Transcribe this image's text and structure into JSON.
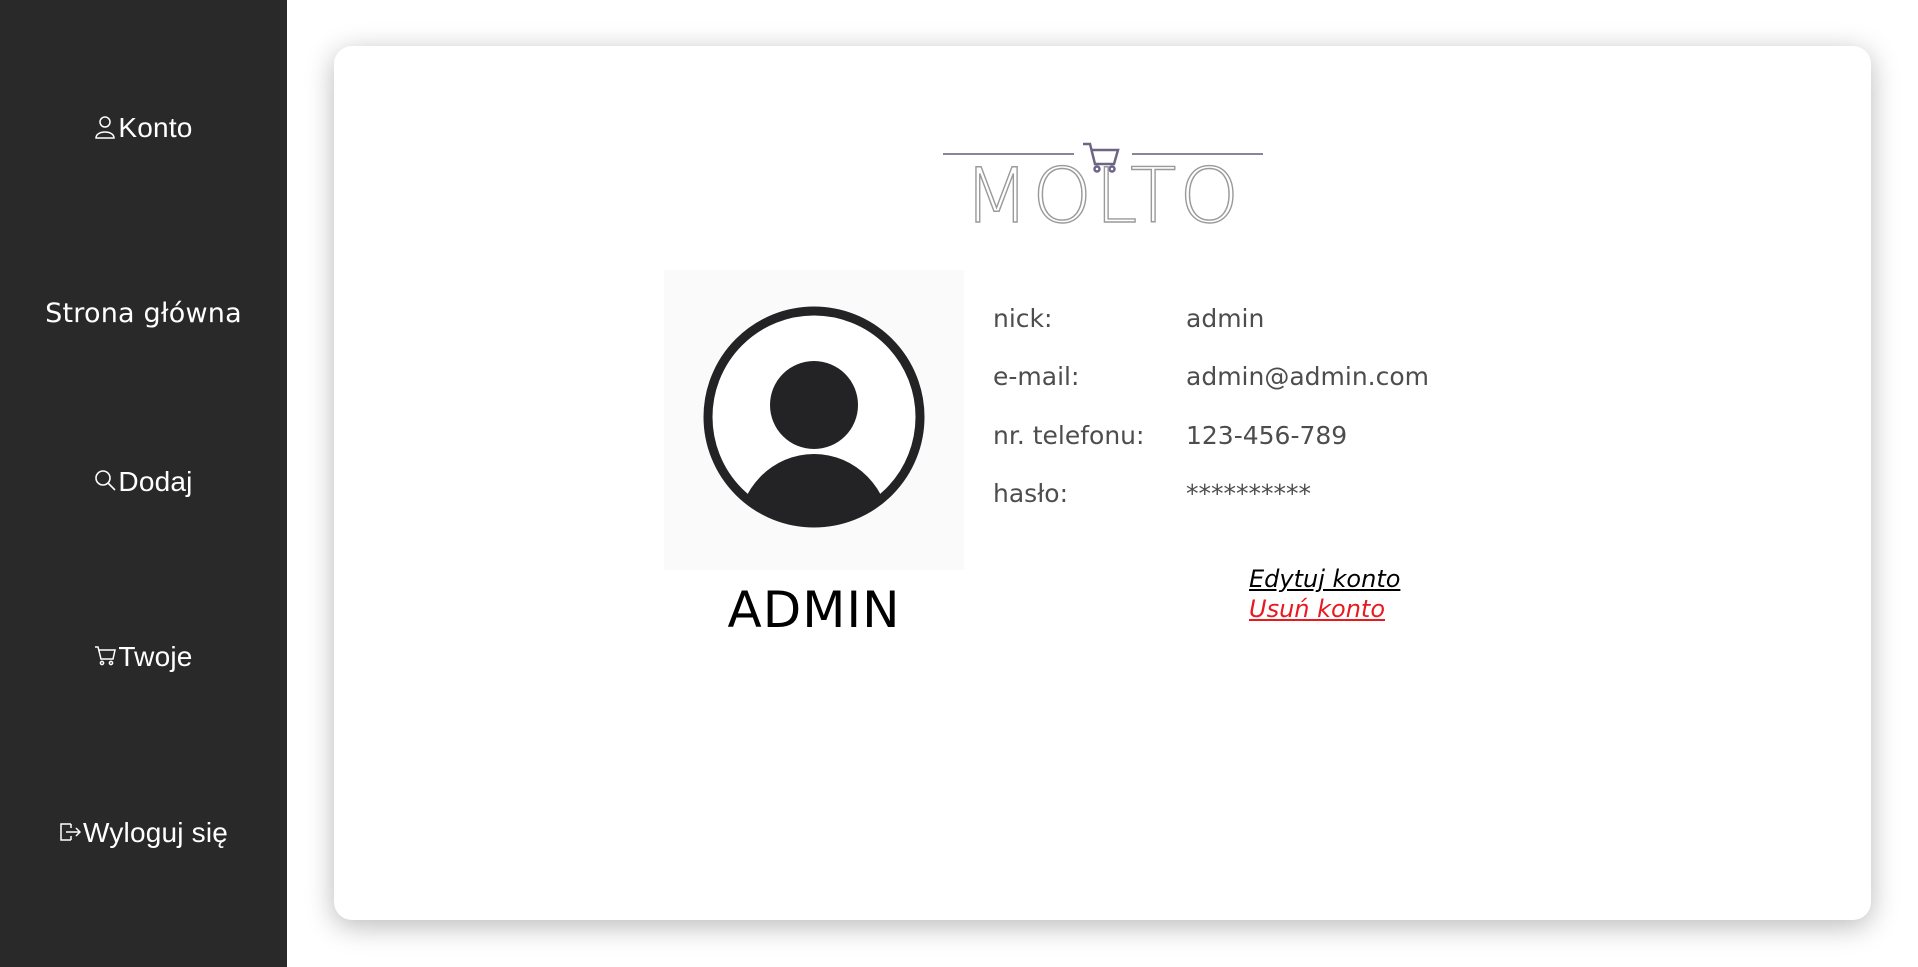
{
  "sidebar": {
    "items": [
      {
        "label": "Konto",
        "icon": "user-icon"
      },
      {
        "label": "Strona główna",
        "icon": ""
      },
      {
        "label": "Dodaj",
        "icon": "search-icon"
      },
      {
        "label": "Twoje",
        "icon": "cart-icon"
      },
      {
        "label": "Wyloguj się",
        "icon": "logout-icon"
      }
    ],
    "background": "#292929"
  },
  "logo": {
    "text": "MOLTO",
    "icon": "cart-icon",
    "color": "#7a6f8f"
  },
  "profile": {
    "avatar_icon": "user-avatar-icon",
    "username": "ADMIN",
    "fields": [
      {
        "label": "nick:",
        "value": "admin"
      },
      {
        "label": "e-mail:",
        "value": "admin@admin.com"
      },
      {
        "label": "nr. telefonu:",
        "value": "123-456-789"
      },
      {
        "label": "hasło:",
        "value": "**********"
      }
    ]
  },
  "actions": {
    "edit_label": "Edytuj konto",
    "delete_label": "Usuń konto",
    "delete_color": "#e8191f"
  }
}
